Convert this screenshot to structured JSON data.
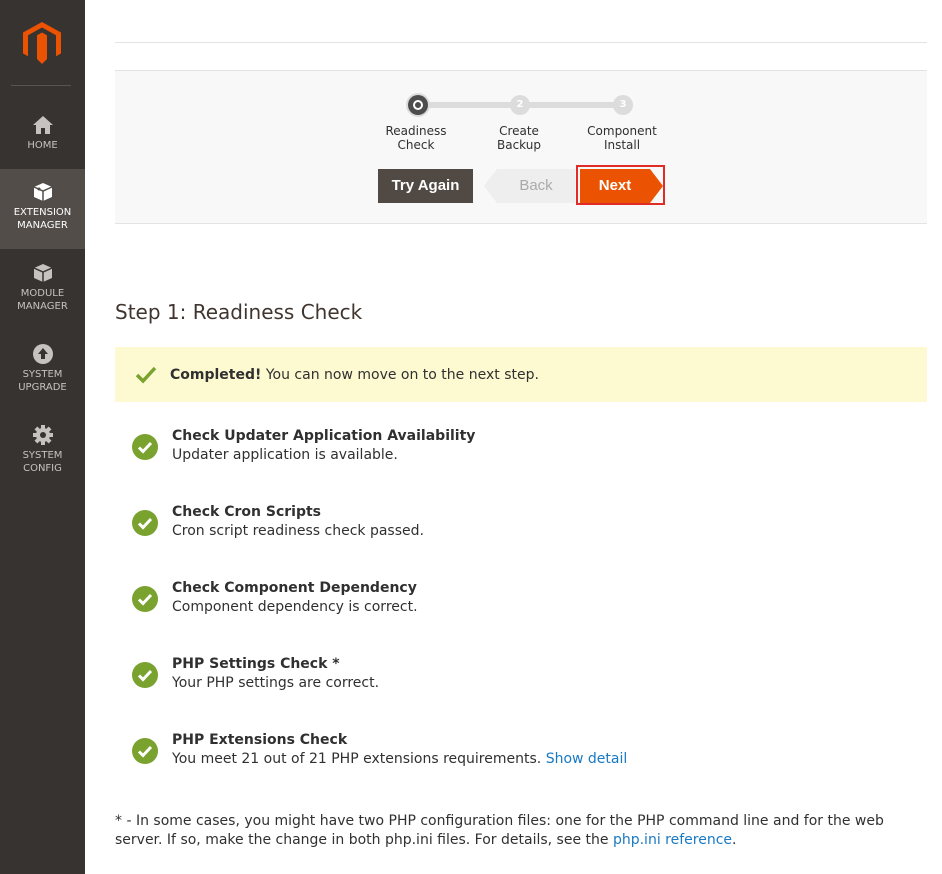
{
  "sidebar": {
    "items": [
      {
        "label": "Home",
        "icon": "home-icon"
      },
      {
        "label": "Extension\nManager",
        "icon": "box-icon"
      },
      {
        "label": "Module\nManager",
        "icon": "cube-icon"
      },
      {
        "label": "System\nUpgrade",
        "icon": "upload-icon"
      },
      {
        "label": "System\nConfig",
        "icon": "gear-icon"
      }
    ],
    "active_index": 1
  },
  "wizard": {
    "steps": [
      {
        "number": "1",
        "label": "Readiness\nCheck"
      },
      {
        "number": "2",
        "label": "Create\nBackup"
      },
      {
        "number": "3",
        "label": "Component\nInstall"
      }
    ],
    "current_step": 1,
    "buttons": {
      "try_again": "Try Again",
      "back": "Back",
      "next": "Next"
    }
  },
  "page_title": "Step 1: Readiness Check",
  "notice": {
    "strong": "Completed!",
    "text": " You can now move on to the next step."
  },
  "checks": [
    {
      "title": "Check Updater Application Availability",
      "desc": "Updater application is available."
    },
    {
      "title": "Check Cron Scripts",
      "desc": "Cron script readiness check passed."
    },
    {
      "title": "Check Component Dependency",
      "desc": "Component dependency is correct."
    },
    {
      "title": "PHP Settings Check *",
      "desc": "Your PHP settings are correct."
    },
    {
      "title": "PHP Extensions Check",
      "desc": "You meet 21 out of 21 PHP extensions requirements.",
      "link": "Show detail"
    }
  ],
  "footnote": {
    "text": "* - In some cases, you might have two PHP configuration files: one for the PHP command line and for the web server. If so, make the change in both php.ini files. For details, see the ",
    "link": "php.ini reference",
    "end": "."
  },
  "colors": {
    "sidebar": "#373330",
    "accent": "#eb5202",
    "success": "#79a22e",
    "notice_bg": "#fdf9d1",
    "link": "#1979c3"
  }
}
